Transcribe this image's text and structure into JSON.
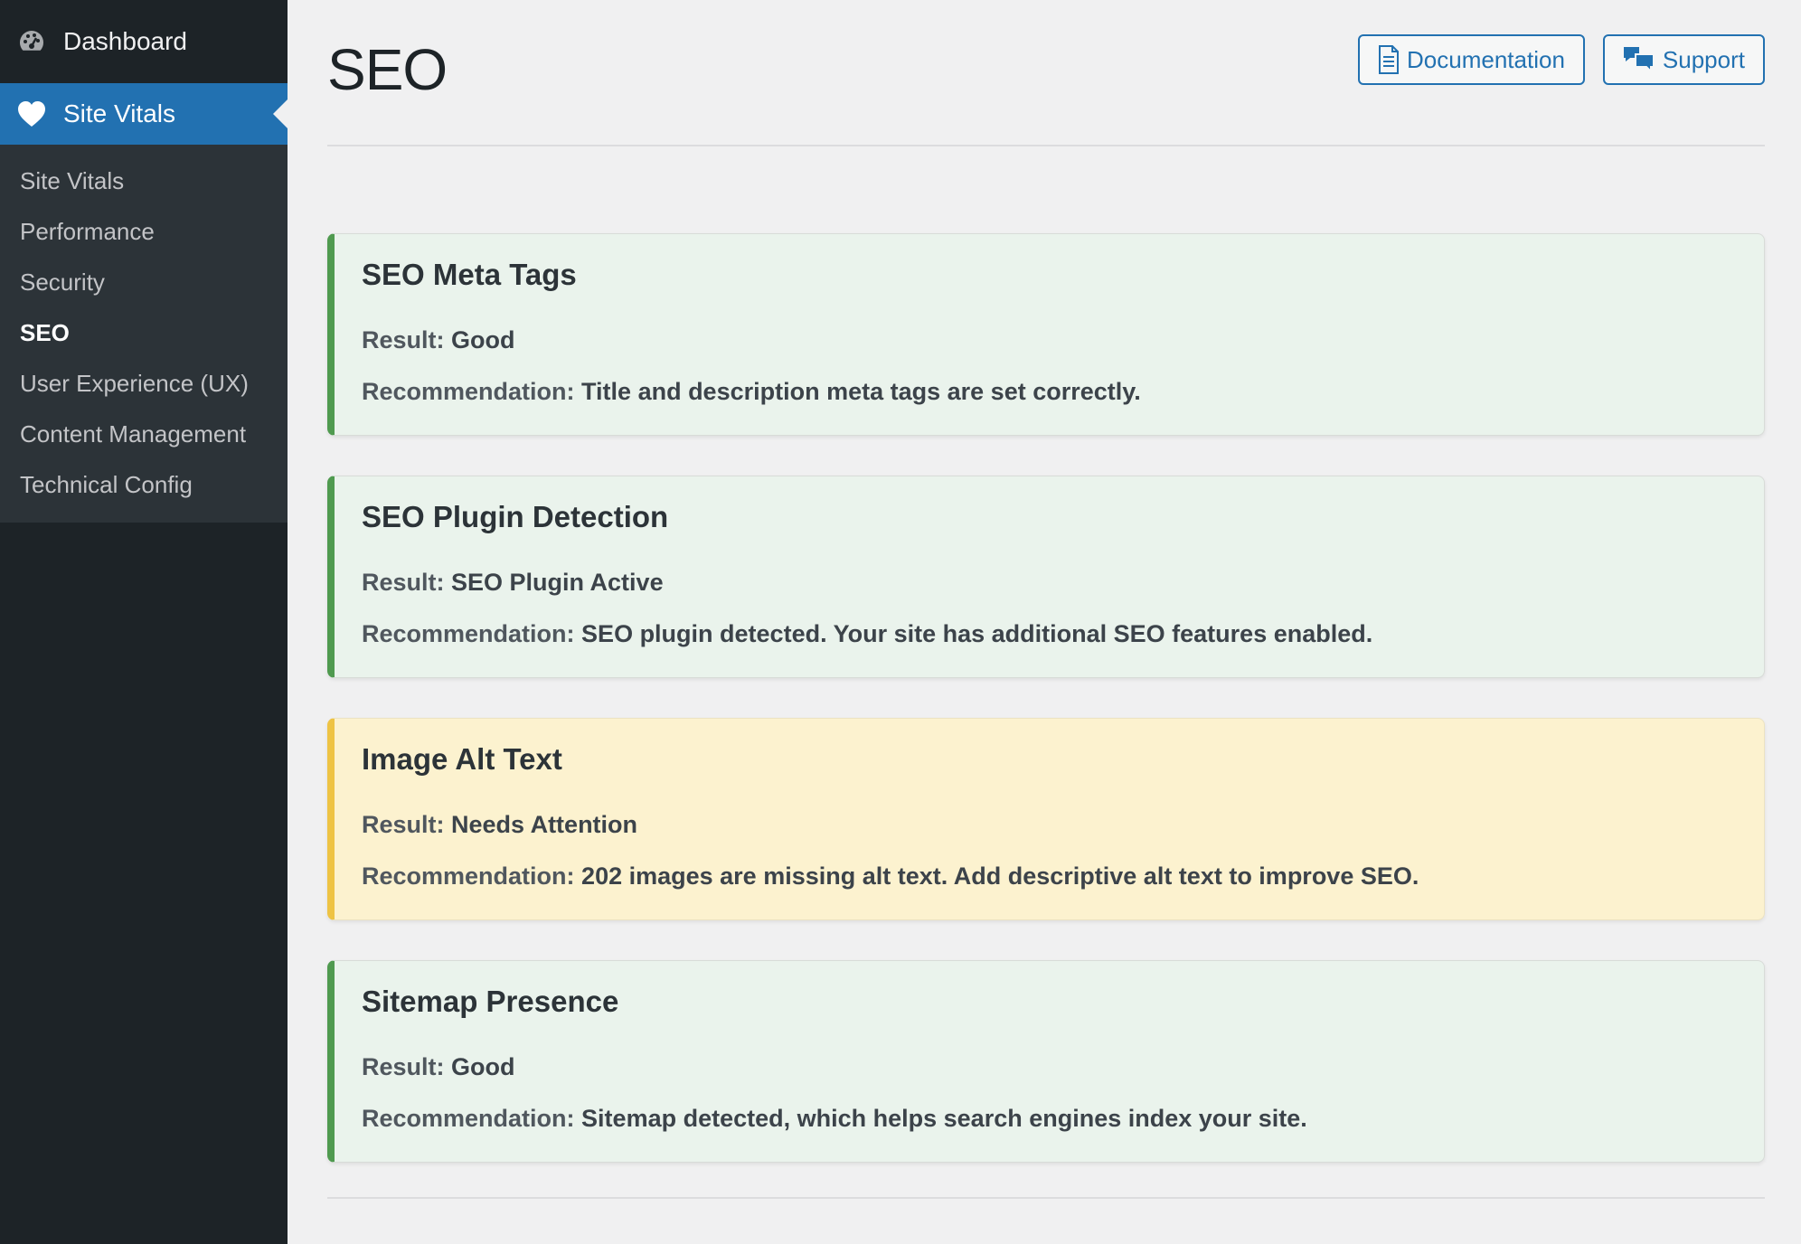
{
  "sidebar": {
    "dashboard": {
      "label": "Dashboard",
      "icon": "dashboard-gauge-icon"
    },
    "active": {
      "label": "Site Vitals",
      "icon": "heart-icon",
      "color": "#2271b1"
    },
    "submenu": [
      {
        "label": "Site Vitals"
      },
      {
        "label": "Performance"
      },
      {
        "label": "Security"
      },
      {
        "label": "SEO",
        "current": true
      },
      {
        "label": "User Experience (UX)"
      },
      {
        "label": "Content Management"
      },
      {
        "label": "Technical Config"
      }
    ]
  },
  "header": {
    "title": "SEO",
    "documentation_label": "Documentation",
    "support_label": "Support"
  },
  "cards": [
    {
      "title": "SEO Meta Tags",
      "result_label": "Result:",
      "result": "Good",
      "recommendation_label": "Recommendation:",
      "recommendation": "Title and description meta tags are set correctly.",
      "status": "good"
    },
    {
      "title": "SEO Plugin Detection",
      "result_label": "Result:",
      "result": "SEO Plugin Active",
      "recommendation_label": "Recommendation:",
      "recommendation": "SEO plugin detected. Your site has additional SEO features enabled.",
      "status": "good"
    },
    {
      "title": "Image Alt Text",
      "result_label": "Result:",
      "result": "Needs Attention",
      "recommendation_label": "Recommendation:",
      "recommendation": "202 images are missing alt text. Add descriptive alt text to improve SEO.",
      "status": "warning"
    },
    {
      "title": "Sitemap Presence",
      "result_label": "Result:",
      "result": "Good",
      "recommendation_label": "Recommendation:",
      "recommendation": "Sitemap detected, which helps search engines index your site.",
      "status": "good"
    }
  ],
  "colors": {
    "good_border": "#4f9a4f",
    "good_bg": "#eaf3ec",
    "warning_border": "#eec344",
    "warning_bg": "#fcf2cf",
    "accent": "#2271b1"
  }
}
